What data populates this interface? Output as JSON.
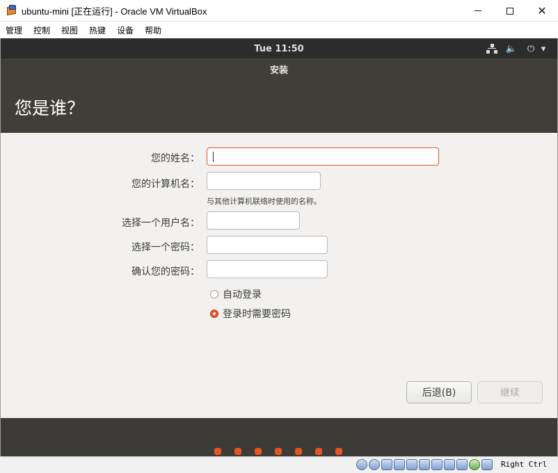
{
  "window": {
    "title": "ubuntu-mini [正在运行] - Oracle VM VirtualBox",
    "controls": {
      "minimize": "",
      "maximize": "",
      "close": "✕"
    }
  },
  "menu": {
    "items": [
      {
        "label": "管理"
      },
      {
        "label": "控制"
      },
      {
        "label": "视图"
      },
      {
        "label": "热键"
      },
      {
        "label": "设备"
      },
      {
        "label": "帮助"
      }
    ]
  },
  "ubuntu_panel": {
    "clock": "Tue 11:50",
    "icons": [
      "network-icon",
      "volume-icon",
      "power-icon",
      "chevron-down-icon"
    ],
    "volume_glyph": "🔈",
    "power_glyph": "⏻",
    "chevron_glyph": "▾"
  },
  "installer": {
    "window_title": "安装",
    "page_title": "您是谁？",
    "form": {
      "name_label": "您的姓名：",
      "name_value": "",
      "computer_label": "您的计算机名：",
      "computer_value": "",
      "computer_hint": "与其他计算机联络时使用的名称。",
      "username_label": "选择一个用户名：",
      "username_value": "",
      "password_label": "选择一个密码：",
      "password_value": "",
      "confirm_label": "确认您的密码：",
      "confirm_value": ""
    },
    "login_options": [
      {
        "label": "自动登录",
        "selected": false
      },
      {
        "label": "登录时需要密码",
        "selected": true
      }
    ],
    "buttons": {
      "back": "后退(B)",
      "continue": "继续"
    },
    "accent_color": "#e95420",
    "slide_dots": 7
  },
  "statusbar": {
    "host_key": "Right Ctrl"
  }
}
